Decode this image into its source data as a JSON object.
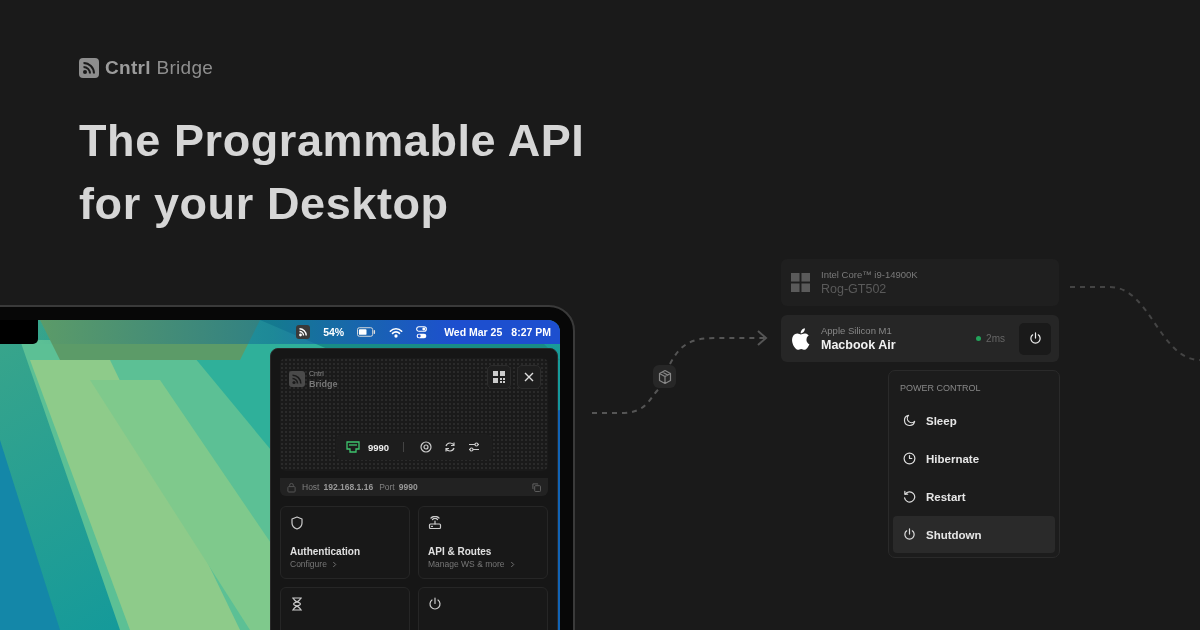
{
  "brand": "**Cntrl** Bridge",
  "headline": [
    "The Programmable API",
    "for your Desktop"
  ],
  "laptop": {
    "menu_bar": {
      "battery": "54%",
      "date": "Wed Mar 25",
      "time": "8:27 PM"
    },
    "panel": {
      "brand_top": "Cntrl",
      "brand_bottom": "Bridge",
      "port": "9990",
      "host_bar": {
        "host_label": "Host",
        "host": "192.168.1.16",
        "port_label": "Port",
        "port": "9990"
      },
      "cards": [
        {
          "kind": "shield",
          "title": "Authentication",
          "subtitle": "Configure"
        },
        {
          "kind": "router",
          "title": "API & Routes",
          "subtitle": "Manage WS & more"
        },
        {
          "kind": "hourglass"
        },
        {
          "kind": "power"
        }
      ]
    }
  },
  "devices": [
    {
      "kind": "windows",
      "chip": "Intel Core™ i9-14900K",
      "name": "Rog-GT502",
      "selected": false
    },
    {
      "kind": "apple",
      "chip": "Apple Silicon M1",
      "name": "Macbook Air",
      "selected": true,
      "latency": "2ms",
      "color": "#22a35a"
    }
  ],
  "power_menu": {
    "title": "POWER CONTROL",
    "items": [
      {
        "kind": "sleep",
        "label": "Sleep",
        "selected": false
      },
      {
        "kind": "hibernate",
        "label": "Hibernate",
        "selected": false
      },
      {
        "kind": "restart",
        "label": "Restart",
        "selected": false
      },
      {
        "kind": "shutdown",
        "label": "Shutdown",
        "selected": true
      }
    ]
  }
}
